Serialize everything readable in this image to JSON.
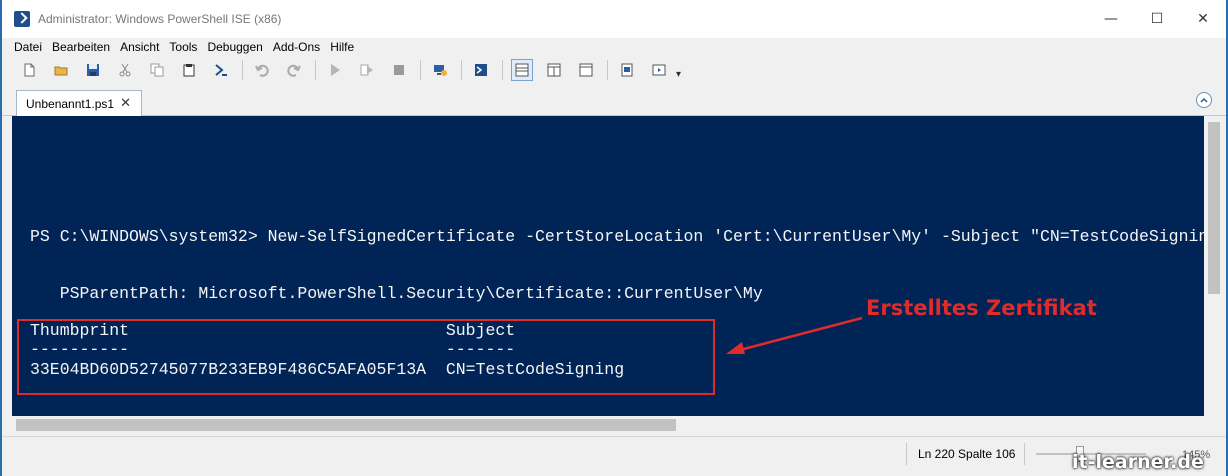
{
  "window": {
    "title": "Administrator: Windows PowerShell ISE (x86)",
    "controls": {
      "minimize": "—",
      "maximize": "☐",
      "close": "✕"
    }
  },
  "menu": {
    "items": [
      "Datei",
      "Bearbeiten",
      "Ansicht",
      "Tools",
      "Debuggen",
      "Add-Ons",
      "Hilfe"
    ]
  },
  "toolbar": {
    "icons": [
      "new-file-icon",
      "open-file-icon",
      "save-icon",
      "cut-icon",
      "copy-icon",
      "paste-icon",
      "powershell-icon",
      "undo-icon",
      "redo-icon",
      "run-icon",
      "run-selection-icon",
      "stop-icon",
      "remote-powershell-icon",
      "powershell-console-icon",
      "show-script-pane-top-icon",
      "show-script-pane-right-icon",
      "show-script-pane-max-icon",
      "show-command-icon",
      "show-command-addon-icon"
    ],
    "more_glyph": "▾"
  },
  "tab": {
    "label": "Unbenannt1.ps1",
    "close_glyph": "✕"
  },
  "console": {
    "command_line": "PS C:\\WINDOWS\\system32> New-SelfSignedCertificate -CertStoreLocation 'Cert:\\CurrentUser\\My' -Subject \"CN=TestCodeSigning\"",
    "parent_path": "   PSParentPath: Microsoft.PowerShell.Security\\Certificate::CurrentUser\\My",
    "table": {
      "header_line": "Thumbprint                                Subject",
      "rule_line": "----------                                -------",
      "row_line": "33E04BD60D52745077B233EB9F486C5AFA05F13A  CN=TestCodeSigning"
    },
    "colors": {
      "background": "#012456",
      "text": "#f5f5f5"
    }
  },
  "status": {
    "position": "Ln 220  Spalte 106",
    "zoom": "145%"
  },
  "annotation": {
    "text": "Erstelltes Zertifikat",
    "color": "#e02b2b"
  },
  "watermark": "it-learner.de"
}
